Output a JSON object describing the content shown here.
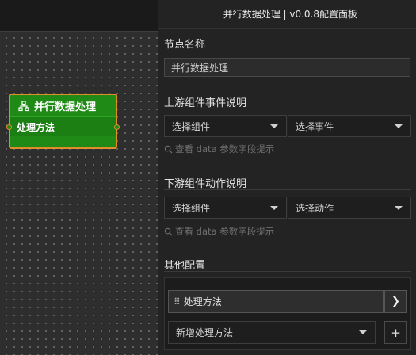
{
  "canvas": {
    "node": {
      "title": "并行数据处理",
      "icon": "hierarchy-icon",
      "rows": [
        {
          "label": "处理方法"
        }
      ],
      "colors": {
        "fill": "#1f8a16",
        "border": "#e08e2a"
      }
    }
  },
  "panel": {
    "title": "并行数据处理 | v0.0.8配置面板",
    "node_name": {
      "label": "节点名称",
      "value": "并行数据处理"
    },
    "upstream": {
      "label": "上游组件事件说明",
      "component_select": "选择组件",
      "event_select": "选择事件",
      "hint": "查看 data 参数字段提示"
    },
    "downstream": {
      "label": "下游组件动作说明",
      "component_select": "选择组件",
      "action_select": "选择动作",
      "hint": "查看 data 参数字段提示"
    },
    "other": {
      "label": "其他配置",
      "drag_handle": "⠿",
      "method_item": "处理方法",
      "expand_arrow": "❯",
      "add_select": "新增处理方法",
      "plus": "+"
    }
  }
}
